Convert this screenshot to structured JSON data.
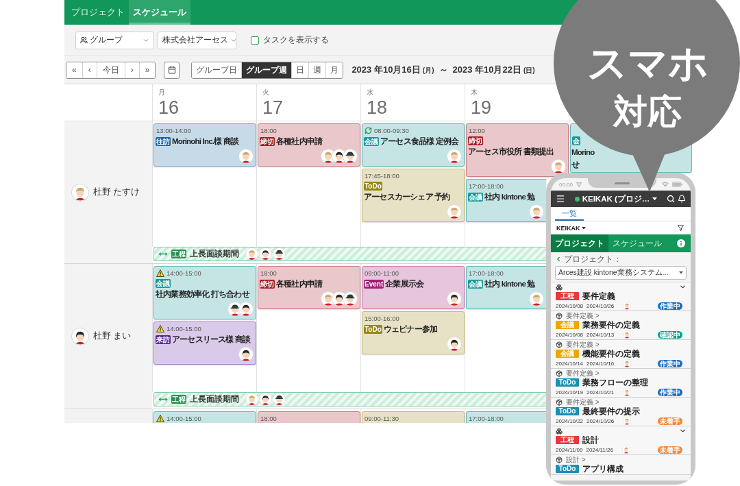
{
  "app_tabs": [
    {
      "label": "プロジェクト",
      "selected": false
    },
    {
      "label": "スケジュール",
      "selected": true
    }
  ],
  "filters": {
    "group_select": "グループ",
    "company_select": "株式会社アーセス",
    "show_tasks": {
      "label": "タスクを表示する",
      "checked": false
    }
  },
  "nav_buttons": [
    "«",
    "‹",
    "今日",
    "›",
    "»"
  ],
  "view_modes": [
    {
      "label": "グループ日",
      "selected": false
    },
    {
      "label": "グループ週",
      "selected": true
    },
    {
      "label": "日",
      "selected": false
    },
    {
      "label": "週",
      "selected": false
    },
    {
      "label": "月",
      "selected": false
    }
  ],
  "date_range": {
    "start": "2023 年10月16日",
    "start_weekday": "(月)",
    "separator": "～",
    "end": "2023 年10月22日",
    "end_weekday": "(日)"
  },
  "days": [
    {
      "weekday": "月",
      "date": "16"
    },
    {
      "weekday": "火",
      "date": "17"
    },
    {
      "weekday": "水",
      "date": "18"
    },
    {
      "weekday": "木",
      "date": "19"
    }
  ],
  "rows": [
    {
      "person": {
        "name": "杜野 たすけ",
        "avatar": {
          "kind": "tan"
        }
      },
      "cells": [
        [
          {
            "kind": "visit",
            "time": "13:00-14:00",
            "badge": "往訪",
            "title": "Morinohi Inc.様 商談",
            "recurring": false,
            "warning": false,
            "avatars": [
              {
                "kind": "tan"
              }
            ]
          }
        ],
        [
          {
            "kind": "deadline",
            "time": "18:00",
            "badge": "締切",
            "title": "各種社内申請",
            "recurring": false,
            "warning": false,
            "avatars": [
              {
                "kind": "tan"
              },
              {
                "kind": "dark"
              },
              {
                "kind": "cap"
              }
            ]
          }
        ],
        [
          {
            "kind": "meeting",
            "time": "08:00-09:30",
            "badge": "会議",
            "title": "アーセス食品様 定例会",
            "recurring": true,
            "warning": false,
            "avatars": [
              {
                "kind": "tan"
              }
            ]
          },
          {
            "kind": "todo",
            "time": "17:45-18:00",
            "badge": "ToDo",
            "title": "アーセスカーシェア 予約",
            "recurring": false,
            "warning": false,
            "avatars": [
              {
                "kind": "tan"
              }
            ]
          }
        ],
        [
          {
            "kind": "deadline",
            "time": "12:00",
            "badge": "締切",
            "title": "アーセス市役所 書類提出",
            "recurring": false,
            "warning": false,
            "avatars": [
              {
                "kind": "tan"
              }
            ]
          },
          {
            "kind": "meeting",
            "time": "17:00-18:00",
            "badge": "会議",
            "title": "社内 kintone 勉",
            "recurring": false,
            "warning": false,
            "avatars": [
              {
                "kind": "tan"
              }
            ]
          }
        ],
        [
          {
            "kind": "meeting",
            "badge": "会",
            "title_lines": [
              "Morino",
              "せ"
            ],
            "recurring": false,
            "warning": false
          }
        ]
      ],
      "span_bar": {
        "badge": "工程",
        "title": "上長面談期間",
        "avatars": [
          {
            "kind": "tan"
          },
          {
            "kind": "dark"
          },
          {
            "kind": "cap"
          }
        ]
      }
    },
    {
      "person": {
        "name": "杜野 まい",
        "avatar": {
          "kind": "dark"
        }
      },
      "cells": [
        [
          {
            "kind": "meeting",
            "time": "14:00-15:00",
            "badge": "会議",
            "title": "社内業務効率化 打ち合わせ",
            "recurring": false,
            "warning": true,
            "avatars": [
              {
                "kind": "cap"
              },
              {
                "kind": "dark"
              }
            ]
          },
          {
            "kind": "guest",
            "time": "14:00-15:00",
            "badge": "来訪",
            "title": "アーセスリース様 商談",
            "recurring": false,
            "warning": true,
            "avatars": [
              {
                "kind": "dark"
              }
            ]
          }
        ],
        [
          {
            "kind": "deadline",
            "time": "18:00",
            "badge": "締切",
            "title": "各種社内申請",
            "recurring": false,
            "warning": false,
            "avatars": [
              {
                "kind": "tan"
              },
              {
                "kind": "dark"
              },
              {
                "kind": "cap"
              }
            ]
          }
        ],
        [
          {
            "kind": "event",
            "time": "09:00-11:00",
            "badge": "Event",
            "title": "企業展示会",
            "recurring": false,
            "warning": false,
            "avatars": [
              {
                "kind": "dark"
              }
            ]
          },
          {
            "kind": "todo",
            "time": "15:00-16:00",
            "badge": "ToDo",
            "title": "ウェビナー参加",
            "recurring": false,
            "warning": false,
            "avatars": [
              {
                "kind": "dark"
              }
            ]
          }
        ],
        [
          {
            "kind": "meeting",
            "time": "17:00-18:00",
            "badge": "会議",
            "title": "社内 kintone 勉",
            "recurring": false,
            "warning": false,
            "avatars": [
              {
                "kind": "tan"
              }
            ]
          }
        ]
      ],
      "span_bar": {
        "badge": "工程",
        "title": "上長面談期間",
        "avatars": [
          {
            "kind": "tan"
          },
          {
            "kind": "dark"
          },
          {
            "kind": "cap"
          }
        ]
      }
    },
    {
      "cells": [
        [
          {
            "kind": "meeting",
            "time": "14:00-15:00",
            "recurring": false,
            "warning": true
          }
        ],
        [
          {
            "kind": "deadline",
            "time": "18:00",
            "recurring": false,
            "warning": false
          }
        ],
        [
          {
            "kind": "todo",
            "time": "09:00-11:30",
            "recurring": false,
            "warning": false
          }
        ],
        [
          {
            "kind": "meeting",
            "time": "17:00-18:00",
            "recurring": false,
            "warning": false
          }
        ]
      ]
    }
  ],
  "phone": {
    "status_time": "00:00",
    "app_title": "KEIKAK (プロジ…",
    "tabs": [
      {
        "label": "一覧",
        "selected": true
      }
    ],
    "filter_label": "KEIKAK",
    "sections": [
      {
        "label": "プロジェクト",
        "selected": true
      },
      {
        "label": "スケジュール",
        "selected": false
      }
    ],
    "project_label": "プロジェクト：",
    "project_value": "Arces建設 kintone業務システム...",
    "items": [
      {
        "kind": "process",
        "badge": {
          "label": "工程",
          "color": "#e8383d"
        },
        "title": "要件定義",
        "start": "2024/10/08",
        "end": "2024/10/26",
        "avatar": {
          "kind": "tan"
        },
        "status": {
          "label": "作業中",
          "color": "#1f6fc5"
        }
      },
      {
        "kind": "task",
        "parent": "要件定義 >",
        "badge": {
          "label": "会議",
          "color": "#f0a500"
        },
        "title": "業務要件の定義",
        "start": "2024/10/08",
        "end": "2024/10/13",
        "avatar": {
          "kind": "tan"
        },
        "status": {
          "label": "確認中",
          "color": "#14a08c"
        }
      },
      {
        "kind": "task",
        "parent": "要件定義 >",
        "badge": {
          "label": "会議",
          "color": "#f0a500"
        },
        "title": "機能要件の定義",
        "start": "2024/10/14",
        "end": "2024/10/16",
        "avatar": {
          "kind": "tan"
        },
        "status": {
          "label": "作業中",
          "color": "#1f6fc5"
        }
      },
      {
        "kind": "task",
        "parent": "要件定義 >",
        "badge": {
          "label": "ToDo",
          "color": "#1b8fb3"
        },
        "title": "業務フローの整理",
        "start": "2024/10/19",
        "end": "2024/10/21",
        "avatar": {
          "kind": "tan"
        },
        "status": {
          "label": "作業中",
          "color": "#1f6fc5"
        }
      },
      {
        "kind": "task",
        "parent": "要件定義 >",
        "badge": {
          "label": "ToDo",
          "color": "#1b8fb3"
        },
        "title": "最終要件の提示",
        "start": "2024/10/22",
        "end": "2024/10/26",
        "avatar": {
          "kind": "tan"
        },
        "status": {
          "label": "未着手",
          "color": "#f08a3a"
        }
      },
      {
        "kind": "process",
        "badge": {
          "label": "工程",
          "color": "#e8383d"
        },
        "title": "設計",
        "start": "2024/11/09",
        "end": "2024/11/26",
        "avatar": {
          "kind": "tan"
        },
        "status": {
          "label": "未着手",
          "color": "#f08a3a"
        }
      },
      {
        "kind": "task",
        "parent": "設計 >",
        "badge": {
          "label": "ToDo",
          "color": "#1b8fb3"
        },
        "title": "アプリ構成"
      }
    ]
  },
  "promo_bubble": {
    "lines": [
      "スマホ",
      "対応"
    ]
  }
}
